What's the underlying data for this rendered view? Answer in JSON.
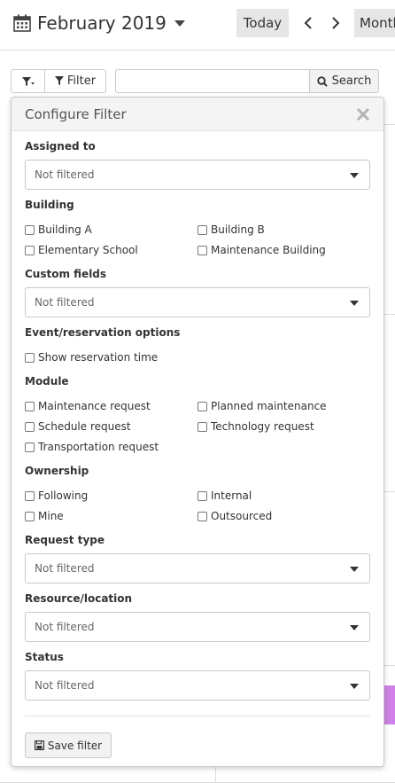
{
  "header": {
    "month": "February 2019",
    "today_label": "Today",
    "view_label": "Month"
  },
  "toolbar": {
    "filter_label": "Filter",
    "search_placeholder": "",
    "search_label": "Search"
  },
  "panel": {
    "title": "Configure Filter",
    "assigned_to": {
      "label": "Assigned to",
      "value": "Not filtered"
    },
    "building": {
      "label": "Building",
      "options": [
        "Building A",
        "Building B",
        "Elementary School",
        "Maintenance Building"
      ]
    },
    "custom_fields": {
      "label": "Custom fields",
      "value": "Not filtered"
    },
    "event_options": {
      "label": "Event/reservation options",
      "options": [
        "Show reservation time"
      ]
    },
    "module": {
      "label": "Module",
      "options": [
        "Maintenance request",
        "Planned maintenance",
        "Schedule request",
        "Technology request",
        "Transportation request"
      ]
    },
    "ownership": {
      "label": "Ownership",
      "options": [
        "Following",
        "Internal",
        "Mine",
        "Outsourced"
      ]
    },
    "request_type": {
      "label": "Request type",
      "value": "Not filtered"
    },
    "resource_location": {
      "label": "Resource/location",
      "value": "Not filtered"
    },
    "status": {
      "label": "Status",
      "value": "Not filtered"
    },
    "save_label": "Save filter"
  },
  "icons": {
    "calendar": "calendar-icon",
    "caret": "caret-down-icon",
    "prev": "chevron-left-icon",
    "next": "chevron-right-icon",
    "filter_toggle": "filter-toggle-icon",
    "filter": "filter-icon",
    "search": "search-icon",
    "close": "close-icon",
    "save": "floppy-disk-icon"
  },
  "colors": {
    "accent_event": "#d07ee8",
    "button_bg": "#e6e6e6"
  }
}
